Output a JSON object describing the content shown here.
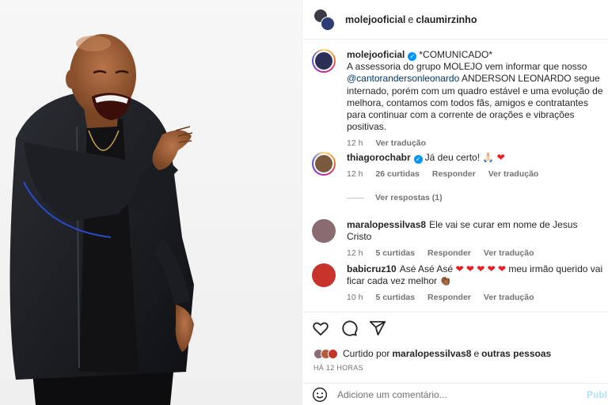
{
  "header": {
    "user1": "molejooficial",
    "separator": "e",
    "user2": "claumirzinho"
  },
  "post": {
    "username": "molejooficial",
    "line1": "*COMUNICADO*",
    "text_a": "A assessoria do grupo MOLEJO vem informar que nosso",
    "mention": "@cantorandersonleonardo",
    "text_b": "ANDERSON LEONARDO segue internado, porém com um quadro estável e uma evolução de melhora, contamos com todos fãs, amigos e contratantes para continuar com a corrente de orações e vibrações positivas.",
    "time": "12 h",
    "translate": "Ver tradução"
  },
  "comments": [
    {
      "username": "thiagorochabr",
      "verified": true,
      "text": "Já deu certo! 🙏🏻 ",
      "heart": "❤",
      "time": "12 h",
      "likes": "26 curtidas",
      "reply": "Responder",
      "translate": "Ver tradução"
    },
    {
      "username": "maralopessilvas8",
      "verified": false,
      "text": "Ele vai se curar em nome de Jesus Cristo",
      "time": "12 h",
      "likes": "5 curtidas",
      "reply": "Responder",
      "translate": "Ver tradução"
    },
    {
      "username": "babicruz10",
      "verified": false,
      "text_a": "Asé Asé Asé",
      "hearts": "❤ ❤ ❤ ❤ ❤",
      "text_b": "meu irmão querido vai ficar cada vez melhor 👏🏾",
      "time": "10 h",
      "likes": "5 curtidas",
      "reply": "Responder",
      "translate": "Ver tradução"
    }
  ],
  "view_replies": "Ver respostas (1)",
  "likes": {
    "prefix": "Curtido por",
    "user": "maralopessilvas8",
    "conj": "e",
    "others": "outras pessoas"
  },
  "time_ago": "HÁ 12 HORAS",
  "add_comment": {
    "placeholder": "Adicione um comentário...",
    "post_label": "Publ"
  },
  "icons": {
    "like": "heart-icon",
    "comment": "comment-icon",
    "share": "share-icon",
    "emoji": "emoji-icon",
    "verified": "verified-badge-icon"
  },
  "colors": {
    "link": "#00376b",
    "verified": "#0095f6",
    "heart": "#ed1c24",
    "muted": "#737373"
  }
}
